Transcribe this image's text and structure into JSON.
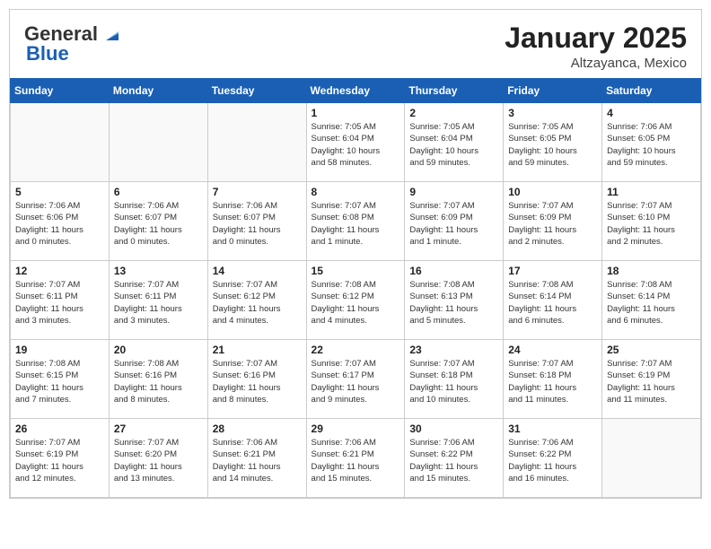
{
  "header": {
    "logo_general": "General",
    "logo_blue": "Blue",
    "month": "January 2025",
    "location": "Altzayanca, Mexico"
  },
  "days_of_week": [
    "Sunday",
    "Monday",
    "Tuesday",
    "Wednesday",
    "Thursday",
    "Friday",
    "Saturday"
  ],
  "weeks": [
    [
      {
        "day": "",
        "info": ""
      },
      {
        "day": "",
        "info": ""
      },
      {
        "day": "",
        "info": ""
      },
      {
        "day": "1",
        "info": "Sunrise: 7:05 AM\nSunset: 6:04 PM\nDaylight: 10 hours\nand 58 minutes."
      },
      {
        "day": "2",
        "info": "Sunrise: 7:05 AM\nSunset: 6:04 PM\nDaylight: 10 hours\nand 59 minutes."
      },
      {
        "day": "3",
        "info": "Sunrise: 7:05 AM\nSunset: 6:05 PM\nDaylight: 10 hours\nand 59 minutes."
      },
      {
        "day": "4",
        "info": "Sunrise: 7:06 AM\nSunset: 6:05 PM\nDaylight: 10 hours\nand 59 minutes."
      }
    ],
    [
      {
        "day": "5",
        "info": "Sunrise: 7:06 AM\nSunset: 6:06 PM\nDaylight: 11 hours\nand 0 minutes."
      },
      {
        "day": "6",
        "info": "Sunrise: 7:06 AM\nSunset: 6:07 PM\nDaylight: 11 hours\nand 0 minutes."
      },
      {
        "day": "7",
        "info": "Sunrise: 7:06 AM\nSunset: 6:07 PM\nDaylight: 11 hours\nand 0 minutes."
      },
      {
        "day": "8",
        "info": "Sunrise: 7:07 AM\nSunset: 6:08 PM\nDaylight: 11 hours\nand 1 minute."
      },
      {
        "day": "9",
        "info": "Sunrise: 7:07 AM\nSunset: 6:09 PM\nDaylight: 11 hours\nand 1 minute."
      },
      {
        "day": "10",
        "info": "Sunrise: 7:07 AM\nSunset: 6:09 PM\nDaylight: 11 hours\nand 2 minutes."
      },
      {
        "day": "11",
        "info": "Sunrise: 7:07 AM\nSunset: 6:10 PM\nDaylight: 11 hours\nand 2 minutes."
      }
    ],
    [
      {
        "day": "12",
        "info": "Sunrise: 7:07 AM\nSunset: 6:11 PM\nDaylight: 11 hours\nand 3 minutes."
      },
      {
        "day": "13",
        "info": "Sunrise: 7:07 AM\nSunset: 6:11 PM\nDaylight: 11 hours\nand 3 minutes."
      },
      {
        "day": "14",
        "info": "Sunrise: 7:07 AM\nSunset: 6:12 PM\nDaylight: 11 hours\nand 4 minutes."
      },
      {
        "day": "15",
        "info": "Sunrise: 7:08 AM\nSunset: 6:12 PM\nDaylight: 11 hours\nand 4 minutes."
      },
      {
        "day": "16",
        "info": "Sunrise: 7:08 AM\nSunset: 6:13 PM\nDaylight: 11 hours\nand 5 minutes."
      },
      {
        "day": "17",
        "info": "Sunrise: 7:08 AM\nSunset: 6:14 PM\nDaylight: 11 hours\nand 6 minutes."
      },
      {
        "day": "18",
        "info": "Sunrise: 7:08 AM\nSunset: 6:14 PM\nDaylight: 11 hours\nand 6 minutes."
      }
    ],
    [
      {
        "day": "19",
        "info": "Sunrise: 7:08 AM\nSunset: 6:15 PM\nDaylight: 11 hours\nand 7 minutes."
      },
      {
        "day": "20",
        "info": "Sunrise: 7:08 AM\nSunset: 6:16 PM\nDaylight: 11 hours\nand 8 minutes."
      },
      {
        "day": "21",
        "info": "Sunrise: 7:07 AM\nSunset: 6:16 PM\nDaylight: 11 hours\nand 8 minutes."
      },
      {
        "day": "22",
        "info": "Sunrise: 7:07 AM\nSunset: 6:17 PM\nDaylight: 11 hours\nand 9 minutes."
      },
      {
        "day": "23",
        "info": "Sunrise: 7:07 AM\nSunset: 6:18 PM\nDaylight: 11 hours\nand 10 minutes."
      },
      {
        "day": "24",
        "info": "Sunrise: 7:07 AM\nSunset: 6:18 PM\nDaylight: 11 hours\nand 11 minutes."
      },
      {
        "day": "25",
        "info": "Sunrise: 7:07 AM\nSunset: 6:19 PM\nDaylight: 11 hours\nand 11 minutes."
      }
    ],
    [
      {
        "day": "26",
        "info": "Sunrise: 7:07 AM\nSunset: 6:19 PM\nDaylight: 11 hours\nand 12 minutes."
      },
      {
        "day": "27",
        "info": "Sunrise: 7:07 AM\nSunset: 6:20 PM\nDaylight: 11 hours\nand 13 minutes."
      },
      {
        "day": "28",
        "info": "Sunrise: 7:06 AM\nSunset: 6:21 PM\nDaylight: 11 hours\nand 14 minutes."
      },
      {
        "day": "29",
        "info": "Sunrise: 7:06 AM\nSunset: 6:21 PM\nDaylight: 11 hours\nand 15 minutes."
      },
      {
        "day": "30",
        "info": "Sunrise: 7:06 AM\nSunset: 6:22 PM\nDaylight: 11 hours\nand 15 minutes."
      },
      {
        "day": "31",
        "info": "Sunrise: 7:06 AM\nSunset: 6:22 PM\nDaylight: 11 hours\nand 16 minutes."
      },
      {
        "day": "",
        "info": ""
      }
    ]
  ]
}
